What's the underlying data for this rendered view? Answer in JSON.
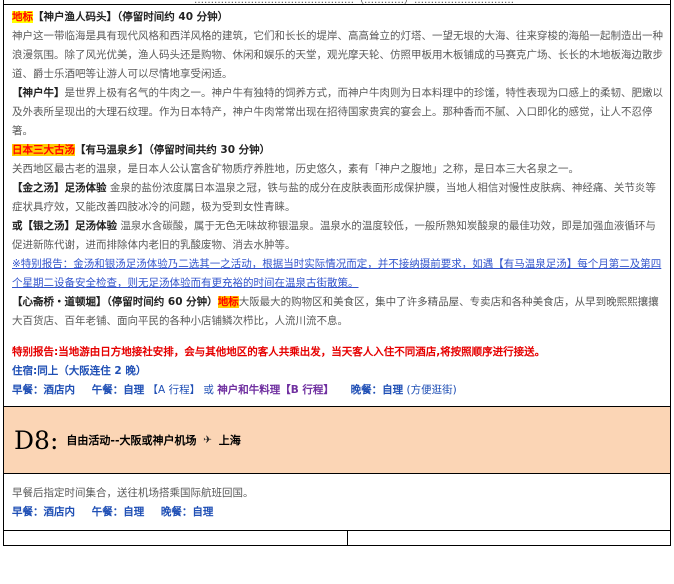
{
  "top_cut": "…………………………………………（…………）…………………………",
  "p1_tag": "地标",
  "p1_title": "【神户渔人码头】（停留时间约 40 分钟）",
  "p1_text": "神户这一带临海是具有现代风格和西洋风格的建筑，它们和长长的堤岸、高高耸立的灯塔、一望无垠的大海、往来穿梭的海船一起制造出一种浪漫氛围。除了风光优美，渔人码头还是购物、休闲和娱乐的天堂，观光摩天轮、仿照甲板用木板铺成的马赛克广场、长长的木地板海边散步道、爵士乐酒吧等让游人可以尽情地享受闲适。",
  "p2_title": "【神户牛】",
  "p2_text": "是世界上极有名气的牛肉之一。神户牛有独特的饲养方式，而神户牛肉则为日本料理中的珍馐，特性表现为口感上的柔韧、肥嫩以及外表所呈现出的大理石纹理。作为日本特产，神户牛肉常常出现在招待国家贵宾的宴会上。那种香而不腻、入口即化的感觉，让人不忍停箸。",
  "p3_tag": "日本三大古汤",
  "p3_title": "【有马温泉乡】（停留时间共约 30 分钟）",
  "p3_text": "关西地区最古老的温泉，是日本人公认富含矿物质疗养胜地，历史悠久，素有「神户之腹地」之称，是日本三大名泉之一。",
  "p4_title": "【金之汤】足汤体验",
  "p4_text": " 金泉的盐份浓度属日本温泉之冠，铁与盐的成分在皮肤表面形成保护膜，当地人相信对慢性皮肤病、神经痛、关节炎等症状具疗效，又能改善四肢冰冷的问题，极为受到女性青睐。",
  "p5_pre": "或",
  "p5_title": "【银之汤】足汤体验",
  "p5_text": " 温泉水含碳酸，属于无色无味故称银温泉。温泉水的温度较低，一般所熟知炭酸泉的最佳功效，即是加强血液循环与促进新陈代谢，进而排除体内老旧的乳酸废物、消去水肿等。",
  "p6_text": "※特别报告：金汤和银汤足汤体验乃二选其一之活动，根据当时实际情况而定，并不接纳摄前要求，如遇【有马温泉足汤】每个月第二及第四个星期二设备安全检查，则无足汤体验而有更充裕的时间在温泉古街散策。",
  "p7_title": "【心斋桥・道顿堀】（停留时间约 60 分钟）",
  "p7_tag": "地标",
  "p7_text": "大阪最大的购物区和美食区，集中了许多精品屋、专卖店和各种美食店，从早到晚熙熙攘攘大百货店、百年老铺、面向平民的各种小店铺鳞次栉比，人流川流不息。",
  "notice": "特别报告:当地游由日方地接社安排，会与其他地区的客人共乘出发，当天客人入住不同酒店,将按照顺序进行接送。",
  "lodging": "住宿:同上（大阪连住 2 晚）",
  "meals1": {
    "breakfast": "早餐：酒店内",
    "lunch_label": "午餐：自理",
    "lunch_a": "【A 行程】",
    "or": "或",
    "lunch_b": "神户和牛料理",
    "lunch_b_tag": "【B 行程】",
    "dinner_label": "晚餐：自理",
    "dinner_note": "(方便逛街)"
  },
  "day8": {
    "day": "D8:",
    "title": "自由活动--大阪或神户机场",
    "arrow": "✈",
    "dest": "上海"
  },
  "d8_text": "早餐后指定时间集合，送往机场搭乘国际航班回国。",
  "meals2": {
    "breakfast": "早餐：酒店内",
    "lunch": "午餐：自理",
    "dinner": "晚餐：自理"
  }
}
